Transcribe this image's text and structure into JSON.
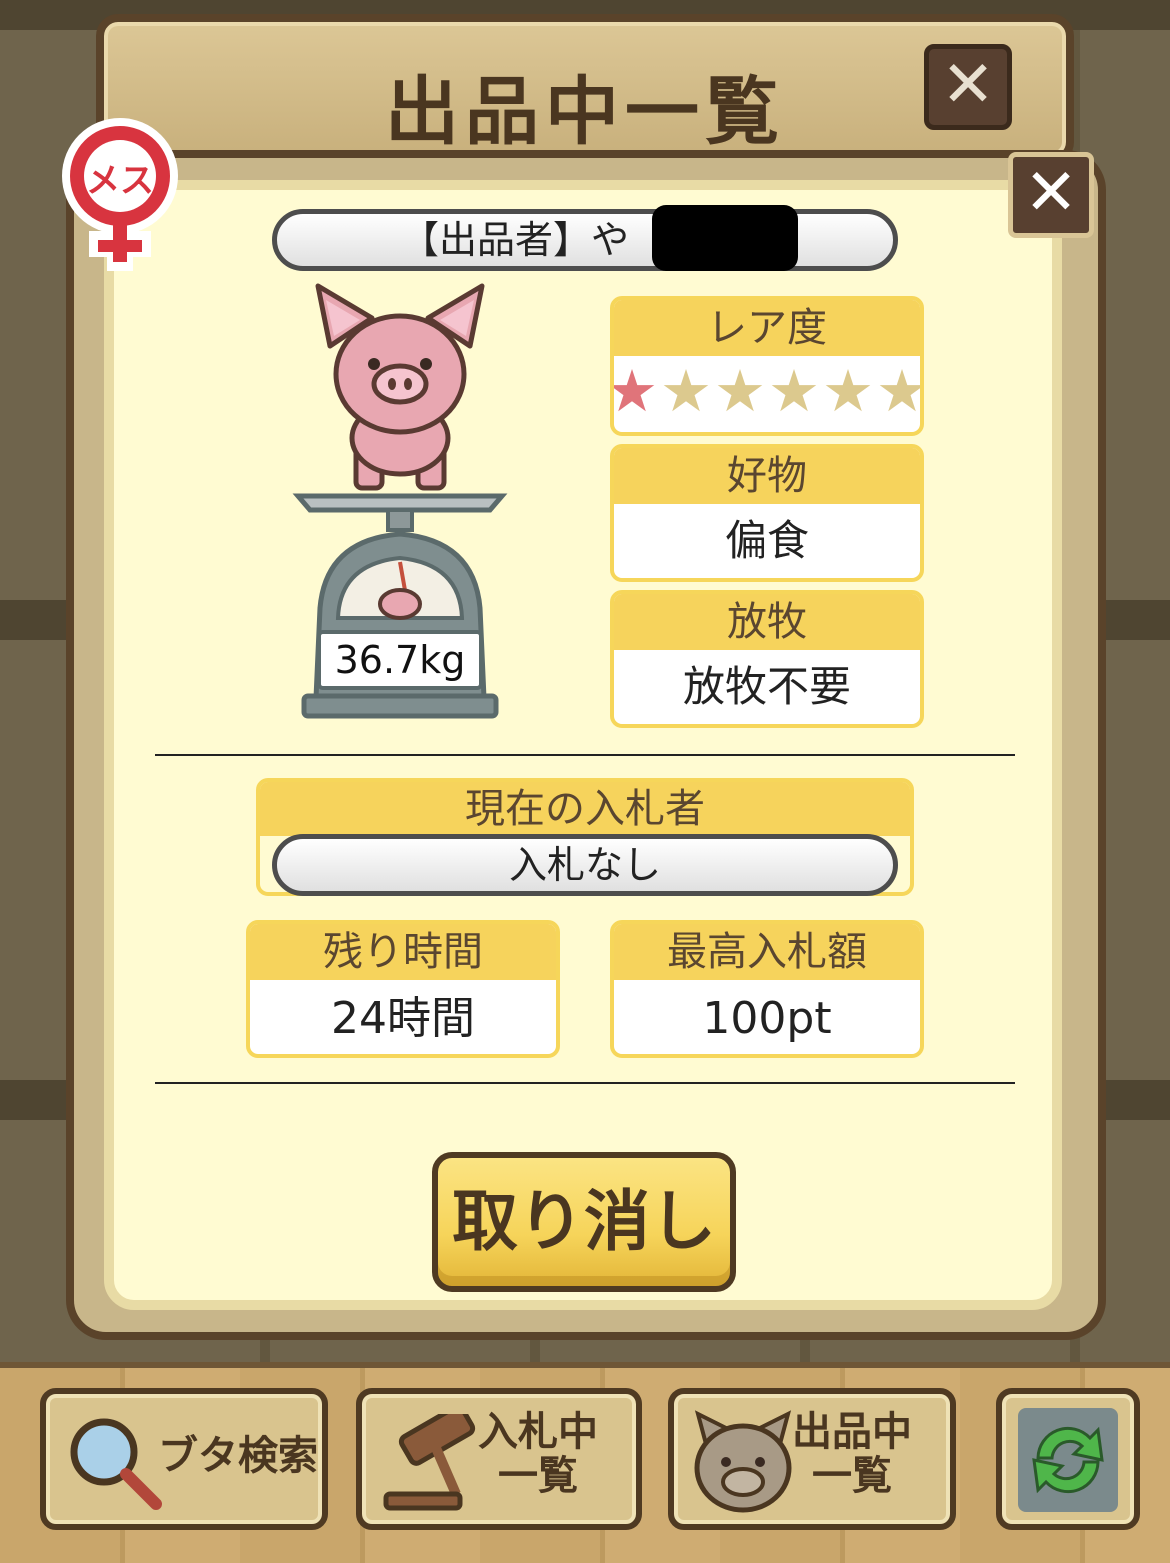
{
  "header": {
    "title": "出品中一覧"
  },
  "listing": {
    "gender_label": "メス",
    "seller_label": "【出品者】や",
    "weight": "36.7kg",
    "rarity": {
      "label": "レア度",
      "stars_filled": 1,
      "stars_total": 6
    },
    "favorite_food": {
      "label": "好物",
      "value": "偏食"
    },
    "grazing": {
      "label": "放牧",
      "value": "放牧不要"
    },
    "current_bidder": {
      "label": "現在の入札者",
      "value": "入札なし"
    },
    "time_left": {
      "label": "残り時間",
      "value": "24時間"
    },
    "highest_bid": {
      "label": "最高入札額",
      "value": "100pt"
    },
    "cancel_label": "取り消し"
  },
  "bottom_tabs": [
    {
      "label": "ブタ検索",
      "icon": "magnifier-icon"
    },
    {
      "label_line1": "入札中",
      "label_line2": "一覧",
      "icon": "gavel-icon"
    },
    {
      "label_line1": "出品中",
      "label_line2": "一覧",
      "icon": "pig-face-icon"
    },
    {
      "icon": "refresh-icon"
    }
  ],
  "colors": {
    "accent_yellow": "#f6d35c",
    "panel_cream": "#fffbd2",
    "frame_brown": "#5a432a"
  }
}
